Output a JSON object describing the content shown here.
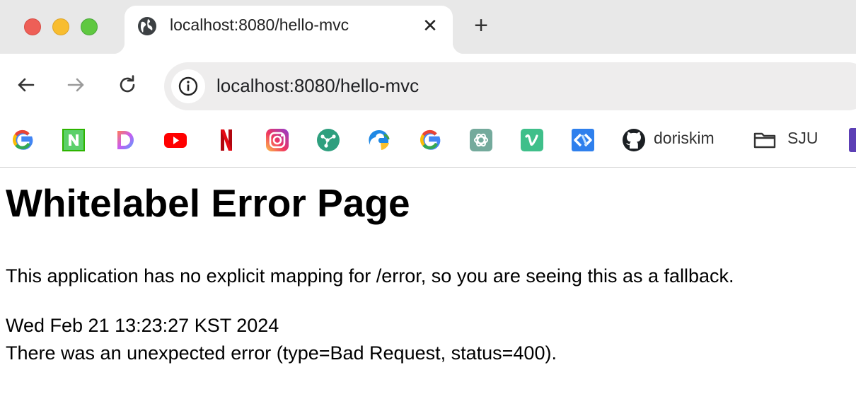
{
  "browser": {
    "tab": {
      "title": "localhost:8080/hello-mvc",
      "favicon": "globe-icon"
    },
    "new_tab_symbol": "+",
    "close_symbol": "✕",
    "address_bar": {
      "url": "localhost:8080/hello-mvc",
      "icon": "info-icon"
    },
    "bookmarks": [
      {
        "icon": "google-icon",
        "label": ""
      },
      {
        "icon": "naver-icon",
        "label": ""
      },
      {
        "icon": "d-app-icon",
        "label": ""
      },
      {
        "icon": "youtube-icon",
        "label": ""
      },
      {
        "icon": "netflix-icon",
        "label": ""
      },
      {
        "icon": "instagram-icon",
        "label": ""
      },
      {
        "icon": "git-graph-icon",
        "label": ""
      },
      {
        "icon": "edge-icon",
        "label": ""
      },
      {
        "icon": "google-icon",
        "label": ""
      },
      {
        "icon": "chatgpt-icon",
        "label": ""
      },
      {
        "icon": "vimeo-icon",
        "label": ""
      },
      {
        "icon": "code-app-icon",
        "label": ""
      },
      {
        "icon": "github-icon",
        "label": "doriskim"
      },
      {
        "icon": "folder-icon",
        "label": "SJU"
      }
    ]
  },
  "page": {
    "title": "Whitelabel Error Page",
    "description": "This application has no explicit mapping for /error, so you are seeing this as a fallback.",
    "timestamp": "Wed Feb 21 13:23:27 KST 2024",
    "error_message": "There was an unexpected error (type=Bad Request, status=400)."
  },
  "colors": {
    "close": "#ee5f57",
    "minimize": "#f8bd2f",
    "maximize": "#5fc840",
    "tabstrip": "#e8e8e8",
    "omnibox": "#eeeded"
  }
}
